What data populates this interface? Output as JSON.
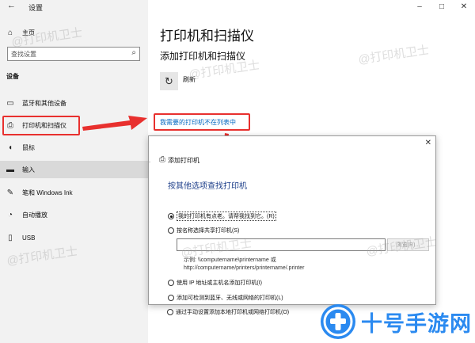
{
  "window": {
    "title": "设置",
    "controls": [
      "–",
      "□",
      "✕"
    ]
  },
  "sidebar": {
    "home_label": "主页",
    "search_placeholder": "查找设置",
    "section_label": "设备",
    "items": [
      {
        "label": "蓝牙和其他设备",
        "icon": "bluetooth-icon"
      },
      {
        "label": "打印机和扫描仪",
        "icon": "printer-icon"
      },
      {
        "label": "鼠标",
        "icon": "mouse-icon"
      },
      {
        "label": "输入",
        "icon": "keyboard-icon"
      },
      {
        "label": "笔和 Windows Ink",
        "icon": "pen-icon"
      },
      {
        "label": "自动播放",
        "icon": "autoplay-icon"
      },
      {
        "label": "USB",
        "icon": "usb-icon"
      }
    ]
  },
  "main": {
    "page_title": "打印机和扫描仪",
    "subtitle": "添加打印机和扫描仪",
    "refresh_label": "刷新",
    "missing_printer_link": "我需要的打印机不在列表中"
  },
  "dialog": {
    "title": "添加打印机",
    "heading": "按其他选项查找打印机",
    "options": [
      {
        "label": "我的打印机有点老。请帮我找到它。(R)",
        "selected": true
      },
      {
        "label": "按名称选择共享打印机(S)",
        "selected": false
      },
      {
        "label": "使用 IP 地址或主机名添加打印机(I)",
        "selected": false
      },
      {
        "label": "添加可检测到蓝牙、无线或网络的打印机(L)",
        "selected": false
      },
      {
        "label": "通过手动设置添加本地打印机或网络打印机(O)",
        "selected": false
      }
    ],
    "share_input_value": "",
    "browse_label": "浏览(R)...",
    "example_line1": "示例: \\\\computername\\printername 或",
    "example_line2": "http://computername/printers/printername/.printer"
  },
  "watermark": "@打印机卫士",
  "brand": {
    "name": "十号手游网",
    "color": "#2b8af0"
  },
  "colors": {
    "highlight_red": "#e8302e",
    "link_blue": "#0067c0",
    "heading_blue": "#1e3f8a"
  }
}
